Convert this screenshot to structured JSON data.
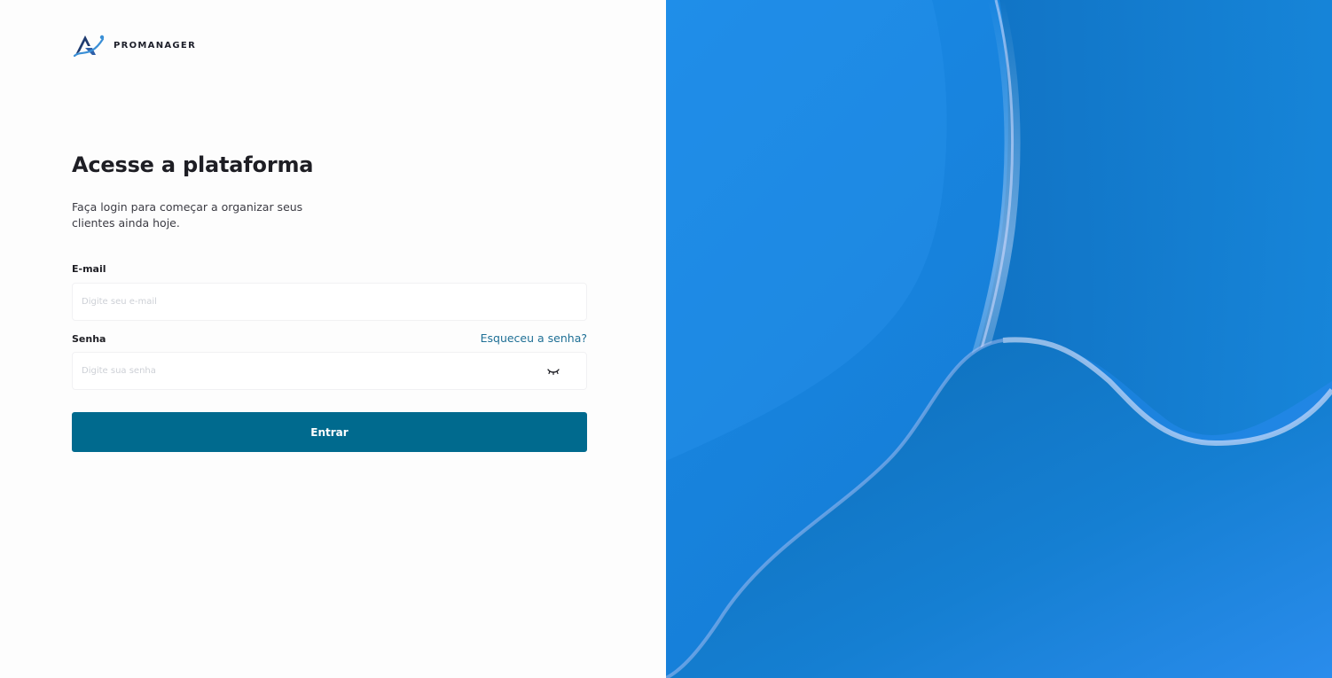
{
  "brand": {
    "name": "PROMANAGER",
    "logo_icon": "promanager-logo-icon",
    "colors": {
      "dark_blue": "#1f3b70",
      "light_blue": "#3a8fd6"
    }
  },
  "login": {
    "title": "Acesse a plataforma",
    "subtitle": "Faça login para começar a organizar seus clientes ainda hoje.",
    "email": {
      "label": "E-mail",
      "placeholder": "Digite seu e-mail",
      "value": ""
    },
    "password": {
      "label": "Senha",
      "placeholder": "Digite sua senha",
      "value": "",
      "toggle_icon": "eye-closed-icon"
    },
    "forgot_link": "Esqueceu a senha?",
    "submit_label": "Entrar"
  },
  "colors": {
    "primary_button": "#006a8e",
    "link": "#1e6f95",
    "art_blue": "#1a86e0",
    "art_deep": "#0f73c6"
  },
  "art": {
    "icon": "abstract-blue-waves"
  }
}
